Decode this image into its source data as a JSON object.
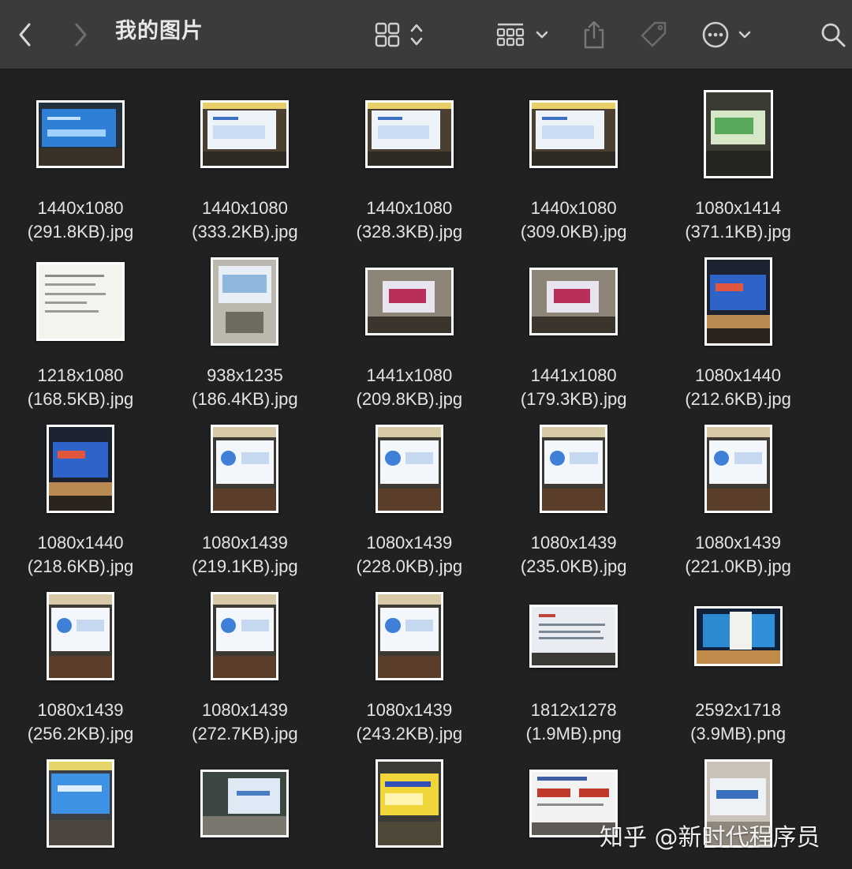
{
  "window": {
    "title": "我的图片",
    "toolbar": {
      "back_icon": "chevron-left-icon",
      "forward_icon": "chevron-right-icon",
      "view_icon": "grid-view-icon",
      "group_icon": "group-by-icon",
      "share_icon": "share-icon",
      "tag_icon": "tag-icon",
      "more_icon": "ellipsis-circle-icon",
      "search_icon": "search-icon"
    }
  },
  "files": [
    {
      "dims": "1440x1080",
      "size": "(291.8KB).jpg",
      "scene": "screen-blue"
    },
    {
      "dims": "1440x1080",
      "size": "(333.2KB).jpg",
      "scene": "screen-white"
    },
    {
      "dims": "1440x1080",
      "size": "(328.3KB).jpg",
      "scene": "screen-white"
    },
    {
      "dims": "1440x1080",
      "size": "(309.0KB).jpg",
      "scene": "screen-white"
    },
    {
      "dims": "1080x1414",
      "size": "(371.1KB).jpg",
      "scene": "room-portrait"
    },
    {
      "dims": "1218x1080",
      "size": "(168.5KB).jpg",
      "scene": "paper"
    },
    {
      "dims": "938x1235",
      "size": "(186.4KB).jpg",
      "scene": "meeting-room"
    },
    {
      "dims": "1441x1080",
      "size": "(209.8KB).jpg",
      "scene": "hall-slide"
    },
    {
      "dims": "1441x1080",
      "size": "(179.3KB).jpg",
      "scene": "hall-slide"
    },
    {
      "dims": "1080x1440",
      "size": "(212.6KB).jpg",
      "scene": "stage-blue"
    },
    {
      "dims": "1080x1440",
      "size": "(218.6KB).jpg",
      "scene": "stage-blue"
    },
    {
      "dims": "1080x1439",
      "size": "(219.1KB).jpg",
      "scene": "screen-portrait"
    },
    {
      "dims": "1080x1439",
      "size": "(228.0KB).jpg",
      "scene": "screen-portrait"
    },
    {
      "dims": "1080x1439",
      "size": "(235.0KB).jpg",
      "scene": "screen-portrait"
    },
    {
      "dims": "1080x1439",
      "size": "(221.0KB).jpg",
      "scene": "screen-portrait"
    },
    {
      "dims": "1080x1439",
      "size": "(256.2KB).jpg",
      "scene": "screen-portrait"
    },
    {
      "dims": "1080x1439",
      "size": "(272.7KB).jpg",
      "scene": "screen-portrait"
    },
    {
      "dims": "1080x1439",
      "size": "(243.2KB).jpg",
      "scene": "screen-portrait"
    },
    {
      "dims": "1812x1278",
      "size": "(1.9MB).png",
      "scene": "slide-text"
    },
    {
      "dims": "2592x1718",
      "size": "(3.9MB).png",
      "scene": "stage-wide"
    },
    {
      "dims": "",
      "size": "",
      "scene": "screen-portrait-blue"
    },
    {
      "dims": "",
      "size": "",
      "scene": "class-screen"
    },
    {
      "dims": "",
      "size": "",
      "scene": "screen-portrait-yellow"
    },
    {
      "dims": "",
      "size": "",
      "scene": "slide-red"
    },
    {
      "dims": "",
      "size": "",
      "scene": "screen-portrait-pale"
    }
  ],
  "watermark": "知乎 @新时代程序员"
}
